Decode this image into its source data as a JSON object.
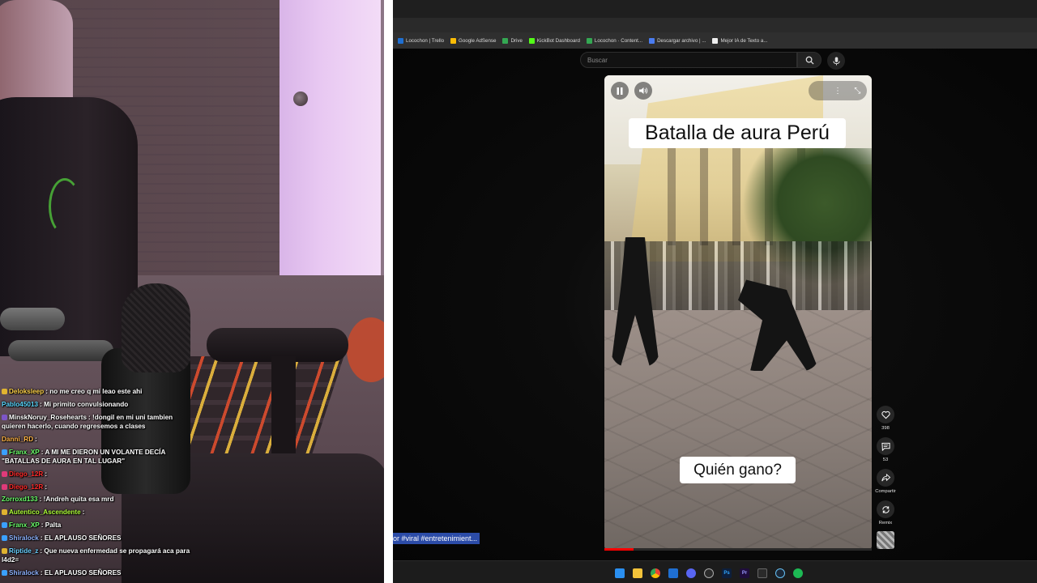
{
  "chat": [
    {
      "user": "Deloksleep",
      "color": "#ffd24a",
      "badge": "#e0b330",
      "text": ": no me creo q mi leao este ahi"
    },
    {
      "user": "Pablo45013",
      "color": "#5ad7ff",
      "badge": "",
      "text": ": Mi primito convulsionando"
    },
    {
      "user": "MinskNoruy_Rosehearts",
      "color": "#ffffff",
      "badge": "#7d55c7",
      "text": ": !dongil en mi uni tambien quieren hacerlo, cuando regresemos a clases"
    },
    {
      "user": "Danni_RD",
      "color": "#ffb347",
      "badge": "",
      "text": ":"
    },
    {
      "user": "Franx_XP",
      "color": "#6bff6b",
      "badge": "#3aa0ff",
      "text": ": A MI ME DIERON UN VOLANTE    DECÍA \"BATALLAS DE AURA EN TAL LUGAR\""
    },
    {
      "user": "Diego_12R",
      "color": "#ff2a2a",
      "badge": "#e03a7a",
      "text": ":"
    },
    {
      "user": "Diego_12R",
      "color": "#ff2a2a",
      "badge": "#e03a7a",
      "text": ":"
    },
    {
      "user": "Zorroxd133",
      "color": "#6bff6b",
      "badge": "",
      "text": ": !Andreh quita esa mrd"
    },
    {
      "user": "Autentico_Ascendente",
      "color": "#b0ff3a",
      "badge": "#e0b330",
      "text": ":"
    },
    {
      "user": "Franx_XP",
      "color": "#6bff6b",
      "badge": "#3aa0ff",
      "text": ": Palta"
    },
    {
      "user": "Shiralock",
      "color": "#8fb3ff",
      "badge": "#3aa0ff",
      "text": ": EL APLAUSO SEÑORES"
    },
    {
      "user": "Riptide_z",
      "color": "#6bd0ff",
      "badge": "#e0b330",
      "text": ": Que nueva enfermedad se propagará aca para l4d2="
    },
    {
      "user": "Shiralock",
      "color": "#8fb3ff",
      "badge": "#3aa0ff",
      "text": ": EL APLAUSO SEÑORES"
    }
  ],
  "bookmarks": [
    {
      "label": "Locochon | Trello",
      "color": "#1f6fd1"
    },
    {
      "label": "Google AdSense",
      "color": "#fbbc05"
    },
    {
      "label": "Drive",
      "color": "#34a853"
    },
    {
      "label": "KickBot Dashboard",
      "color": "#53fc18"
    },
    {
      "label": "Locochon · Content...",
      "color": "#34a853"
    },
    {
      "label": "Descargar archivo | ...",
      "color": "#4a7cf0"
    },
    {
      "label": "Mejor IA de Texto a...",
      "color": "#eeeeee"
    }
  ],
  "search": {
    "placeholder": "Buscar"
  },
  "video": {
    "title": "Batalla de aura Perú",
    "caption": "Quién gano?",
    "progress": 0.11
  },
  "rail": {
    "likes": "398",
    "comments": "53",
    "share": "Compartir",
    "remix": "Remix"
  },
  "hashtags": "or #viral #entretenimient...",
  "icons": {
    "search": "search-icon",
    "mic": "microphone-icon",
    "pause": "pause-icon",
    "volume": "volume-icon",
    "like": "thumbs-up-icon",
    "comment": "comment-icon",
    "share": "share-icon",
    "remix": "remix-icon"
  }
}
